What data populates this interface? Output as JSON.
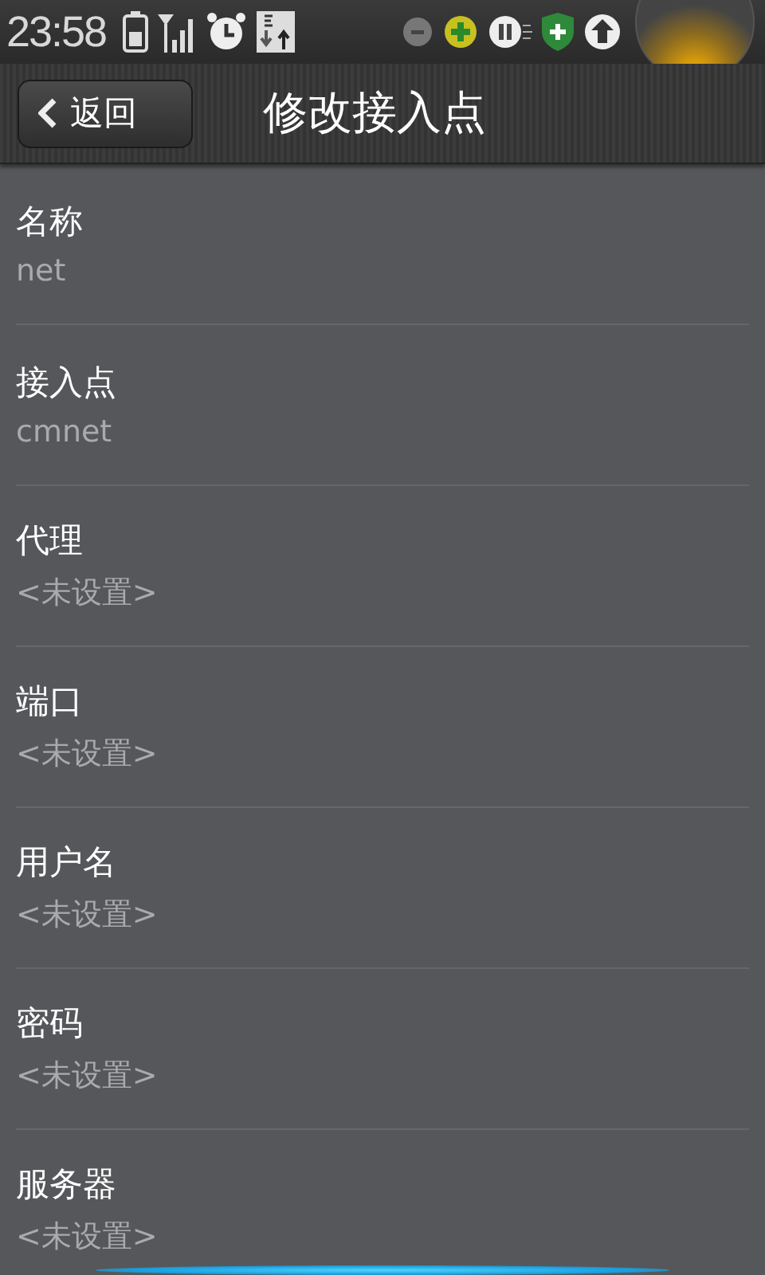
{
  "status_bar": {
    "time": "23:58"
  },
  "header": {
    "back_button": "返回",
    "title": "修改接入点"
  },
  "fields": [
    {
      "label": "名称",
      "value": "net"
    },
    {
      "label": "接入点",
      "value": "cmnet"
    },
    {
      "label": "代理",
      "value": "<未设置>"
    },
    {
      "label": "端口",
      "value": "<未设置>"
    },
    {
      "label": "用户名",
      "value": "<未设置>"
    },
    {
      "label": "密码",
      "value": "<未设置>"
    },
    {
      "label": "服务器",
      "value": "<未设置>"
    }
  ]
}
